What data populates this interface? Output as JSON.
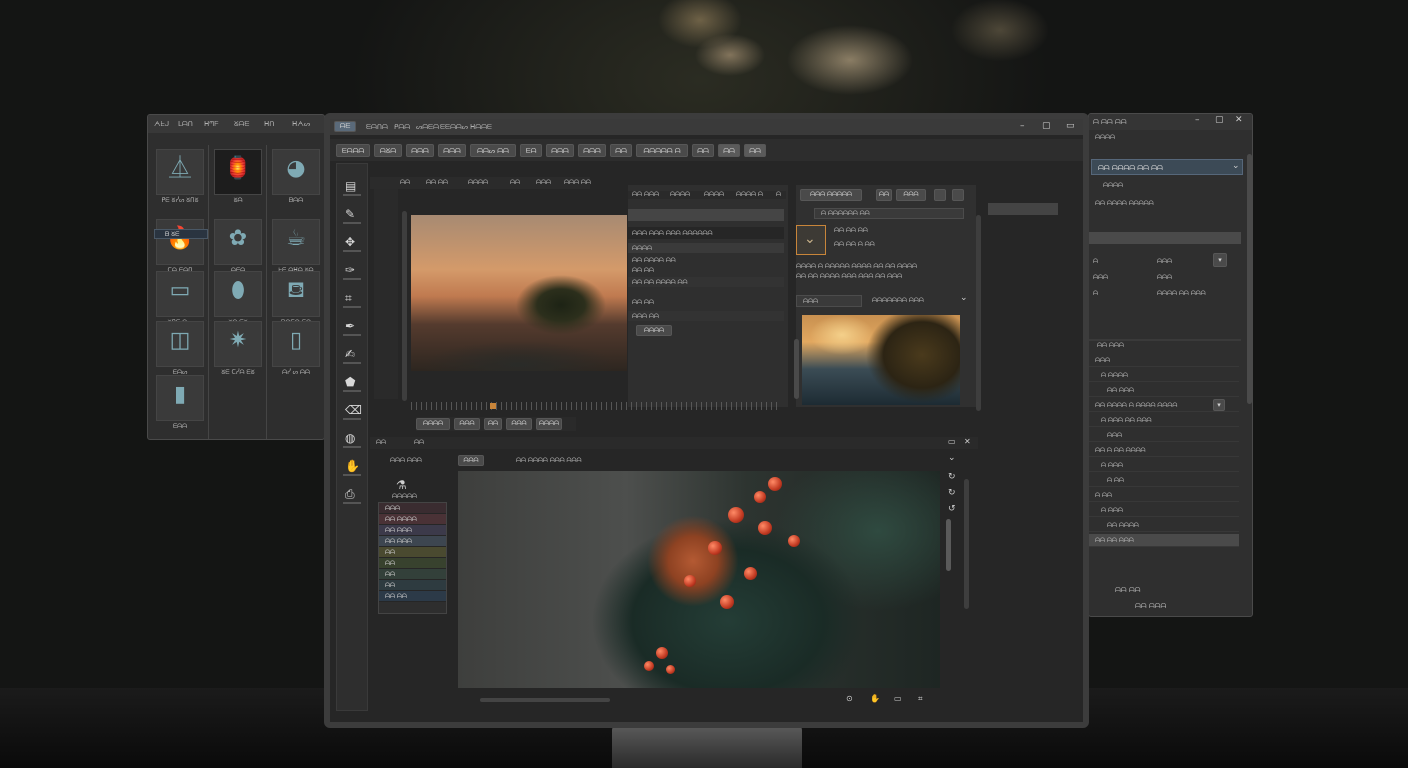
{
  "colors": {
    "panel": "#2c2c2c",
    "accent_selection": "#3c4a56",
    "highlight_orange": "#c8853a"
  },
  "left_window": {
    "menu": [
      "ᗅᖶᒍ",
      "ᒪᗩᑎ",
      "ᕼᘉᖴ",
      "ᘜᗩᗴ",
      "ᕼᑎ",
      "ᕼᗅᔕ"
    ],
    "thumbs": [
      {
        "icon": "funnel-icon",
        "glyph": "⏅",
        "label": "ᑭᗴ ᘜᓰᔕ ᘜᑎᘜ"
      },
      {
        "icon": "lantern-icon",
        "glyph": "🏮",
        "label": "ᘜᗩ"
      },
      {
        "icon": "helmet-icon",
        "glyph": "◕",
        "label": "ᗷᗩᗩ"
      },
      {
        "icon": "fire-icon",
        "glyph": "🔥",
        "label": "ᑕᗩ ᗴᗩᑎ"
      },
      {
        "icon": "flowers-icon",
        "glyph": "✿",
        "label": "ᗩᗴᗩ"
      },
      {
        "icon": "cup-icon",
        "glyph": "☕",
        "label": "ᖶᗴ ᗩᕼᗩ ᘜᗩ"
      },
      {
        "icon": "box-icon",
        "glyph": "▭",
        "label": "ᘜᑎᗴ ᗩᔕ"
      },
      {
        "icon": "bottle-icon",
        "glyph": "⬮",
        "label": "ᘜᗩ ᗴᘜ"
      },
      {
        "icon": "mug-icon",
        "glyph": "⛾",
        "label": "ᗷᗩᑕᗩ ᗴᗩ"
      },
      {
        "icon": "jar-icon",
        "glyph": "◫",
        "label": "ᗴᗩᔕ"
      },
      {
        "icon": "star-burst-icon",
        "glyph": "✷",
        "label": "ᘜᗴ ᑕᓰᗩ ᗴᘜ"
      },
      {
        "icon": "canister-icon",
        "glyph": "▯",
        "label": "ᗩᓰ ᔕ ᗩᗩ"
      },
      {
        "icon": "tablet-icon",
        "glyph": "▮",
        "label": "ᗴᗩᗩ"
      }
    ],
    "selected_label": "ᗷ ᘜᗴ"
  },
  "main_window": {
    "title": "ᗩᗴ",
    "menu": [
      "ᗴᗩᑎᗩ",
      "ᑭᗩᗩ",
      "ᔕᗩᗴᗩ",
      "ᗴᗴᗩᗩᔕ",
      "ᕼᗩᗩᗴ"
    ],
    "tabs": [
      "ᗴᗩᗩᗩ",
      "ᗩᘜᗩ",
      "ᗩᗩᗩ",
      "ᗩᗩᗩ",
      "ᗩᗩᔕ ᗩᗩ",
      "ᗴᗩ",
      "ᗩᗩᗩ",
      "ᗩᗩᗩ",
      "ᗩᗩ",
      "ᗩᗩᗩᗩᗩ ᗩ",
      "ᗩᗩ",
      "ᗩᗩ",
      "ᗩᗩ"
    ],
    "toolbar": [
      "ᗩᗩ",
      "ᗩᗩ ᗩᗩ",
      "ᗩᗩᗩᗩ",
      "ᗩᗩ",
      "ᗩᗩᗩ",
      "ᗩᗩᗩ ᗩᗩ"
    ],
    "property_tabs": [
      "ᗩᗩ",
      "ᗩᗩᗩ",
      "ᗩᗩᗩᗩ",
      "ᗩᗩᗩᗩ",
      "ᗩᗩᗩᗩ ᗩ",
      "ᗩ"
    ],
    "properties": {
      "row1": "ᗩᗩᗩ ᗩᗩᗩ ᗩᗩᗩ ᗩᗩᗩᗩᗩᗩ",
      "row2": "ᗩᗩᗩᗩ",
      "row3": "ᗩᗩ ᗩᗩᗩᗩ ᗩᗩ",
      "row4": "ᗩᗩ ᗩᗩ",
      "row5": "ᗩᗩ ᗩᗩ ᗩᗩᗩᗩ ᗩᗩ",
      "row6": "ᗩᗩ ᗩᗩ",
      "row7": "ᗩᗩᗩ ᗩᗩ",
      "row8": "ᗩᗩᗩᗩ"
    },
    "panel_buttons": [
      "ᗩᗩᗩ",
      "ᗩᗩᗩ",
      "ᗩᗩᗩ",
      "ᗩᗩᗩ"
    ],
    "adjust": {
      "header_btn": "ᗩᗩᗩ ᗩᗩᗩᗩᗩ",
      "small_btn1": "ᗩᗩ",
      "small_btn2": "ᗩᗩᗩ",
      "dropdown": "ᗩ ᗩᗩᗩᗩᗩᗩ ᗩᗩ",
      "line1": "ᗩᗩ ᗩᗩ ᗩᗩ",
      "line2": "ᗩᗩ ᗩᗩ ᗩ ᗩᗩ",
      "desc1": "ᗩᗩᗩᗩ ᗩ ᗩᗩᗩᗩᗩ ᗩᗩᗩᗩ ᗩᗩ ᗩᗩ ᗩᗩᗩᗩ",
      "desc2": "ᗩᗩ ᗩᗩ ᗩᗩᗩᗩ ᗩᗩᗩ ᗩᗩᗩ ᗩᗩ ᗩᗩᗩ",
      "select": "ᗩᗩᗩ",
      "select2": "ᗩᗩᗩᗩᗩᗩᗩ ᗩᗩᗩ"
    },
    "bottom_tabs": [
      "ᗩᗩᗩᗩ",
      "ᗩᗩᗩ",
      "ᗩᗩ",
      "ᗩᗩᗩ",
      "ᗩᗩᗩᗩ"
    ],
    "lower_panel": {
      "title1": "ᗩᗩ",
      "title2": "ᗩᗩ",
      "tool_label": "ᗩᗩᗩ ᗩᗩᗩ",
      "brush_label": "ᗩᗩᗩᗩᗩ",
      "tab_a": "ᗩᗩᗩ",
      "tab_b": "ᗩᗩ ᗩᗩᗩᗩ ᗩᗩᗩ ᗩᗩᗩ"
    },
    "layers": [
      "ᗩᗩᗩ",
      "ᗩᗩ ᗩᗩᗩᗩ",
      "ᗩᗩ ᗩᗩᗩ",
      "ᗩᗩ ᗩᗩᗩ",
      "ᗩᗩ",
      "ᗩᗩ",
      "ᗩᗩ",
      "ᗩᗩ",
      "ᗩᗩ ᗩᗩ"
    ]
  },
  "right_window": {
    "title": "ᗩ ᗩᗩ ᗩᗩ",
    "dropdown": "ᗩᗩ ᗩᗩᗩᗩ ᗩᗩ ᗩᗩ",
    "items": [
      "ᗩᗩᗩᗩ",
      "ᗩᗩ ᗩᗩᗩᗩ ᗩᗩᗩᗩᗩ"
    ],
    "fields": [
      {
        "label": "ᗩ",
        "value": "ᗩᗩᗩ"
      },
      {
        "label": "ᗩᗩᗩ",
        "value": "ᗩᗩᗩ"
      },
      {
        "label": "ᗩ",
        "value": "ᗩᗩᗩᗩ ᗩᗩ ᗩᗩᗩ"
      }
    ],
    "tree_header": "ᗩᗩ ᗩᗩᗩ",
    "tree": [
      "ᗩᗩᗩ",
      "ᗩ ᗩᗩᗩᗩ",
      "ᗩᗩ ᗩᗩᗩ",
      "ᗩᗩ ᗩᗩᗩᗩ ᗩ ᗩᗩᗩᗩ ᗩᗩᗩᗩ",
      "ᗩ ᗩᗩᗩ ᗩᗩ ᗩᗩᗩ",
      "ᗩᗩᗩ",
      "ᗩᗩ ᗩ ᗩᗩ ᗩᗩᗩᗩ",
      "ᗩ ᗩᗩᗩ",
      "ᗩ ᗩᗩ",
      "ᗩ ᗩᗩ",
      "ᗩ ᗩᗩᗩ",
      "ᗩᗩ ᗩᗩᗩᗩ",
      "ᗩᗩ ᗩᗩ ᗩᗩᗩ"
    ],
    "footer1": "ᗩᗩ ᗩᗩ",
    "footer2": "ᗩᗩ ᗩᗩᗩ"
  }
}
